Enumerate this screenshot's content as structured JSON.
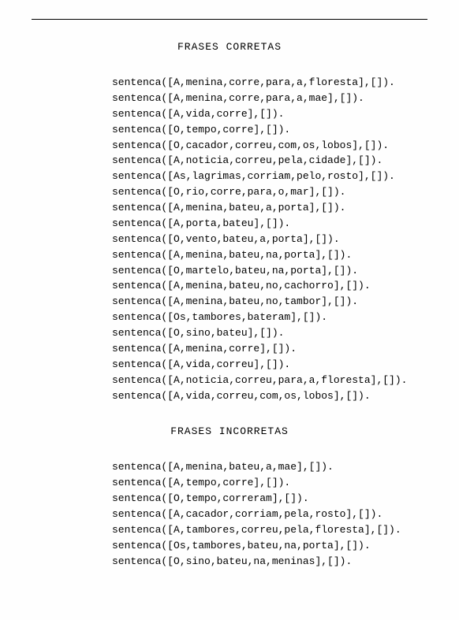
{
  "section1": {
    "title": "FRASES CORRETAS",
    "lines": [
      "sentenca([A,menina,corre,para,a,floresta],[]).",
      "sentenca([A,menina,corre,para,a,mae],[]).",
      "sentenca([A,vida,corre],[]).",
      "sentenca([O,tempo,corre],[]).",
      "sentenca([O,cacador,correu,com,os,lobos],[]).",
      "sentenca([A,noticia,correu,pela,cidade],[]).",
      "sentenca([As,lagrimas,corriam,pelo,rosto],[]).",
      "sentenca([O,rio,corre,para,o,mar],[]).",
      "sentenca([A,menina,bateu,a,porta],[]).",
      "sentenca([A,porta,bateu],[]).",
      "sentenca([O,vento,bateu,a,porta],[]).",
      "sentenca([A,menina,bateu,na,porta],[]).",
      "sentenca([O,martelo,bateu,na,porta],[]).",
      "sentenca([A,menina,bateu,no,cachorro],[]).",
      "sentenca([A,menina,bateu,no,tambor],[]).",
      "sentenca([Os,tambores,bateram],[]).",
      "sentenca([O,sino,bateu],[]).",
      "sentenca([A,menina,corre],[]).",
      "sentenca([A,vida,correu],[]).",
      "sentenca([A,noticia,correu,para,a,floresta],[]).",
      "sentenca([A,vida,correu,com,os,lobos],[])."
    ]
  },
  "section2": {
    "title": "FRASES INCORRETAS",
    "lines": [
      "sentenca([A,menina,bateu,a,mae],[]).",
      "sentenca([A,tempo,corre],[]).",
      "sentenca([O,tempo,correram],[]).",
      "sentenca([A,cacador,corriam,pela,rosto],[]).",
      "sentenca([A,tambores,correu,pela,floresta],[]).",
      "sentenca([Os,tambores,bateu,na,porta],[]).",
      "sentenca([O,sino,bateu,na,meninas],[])."
    ]
  }
}
